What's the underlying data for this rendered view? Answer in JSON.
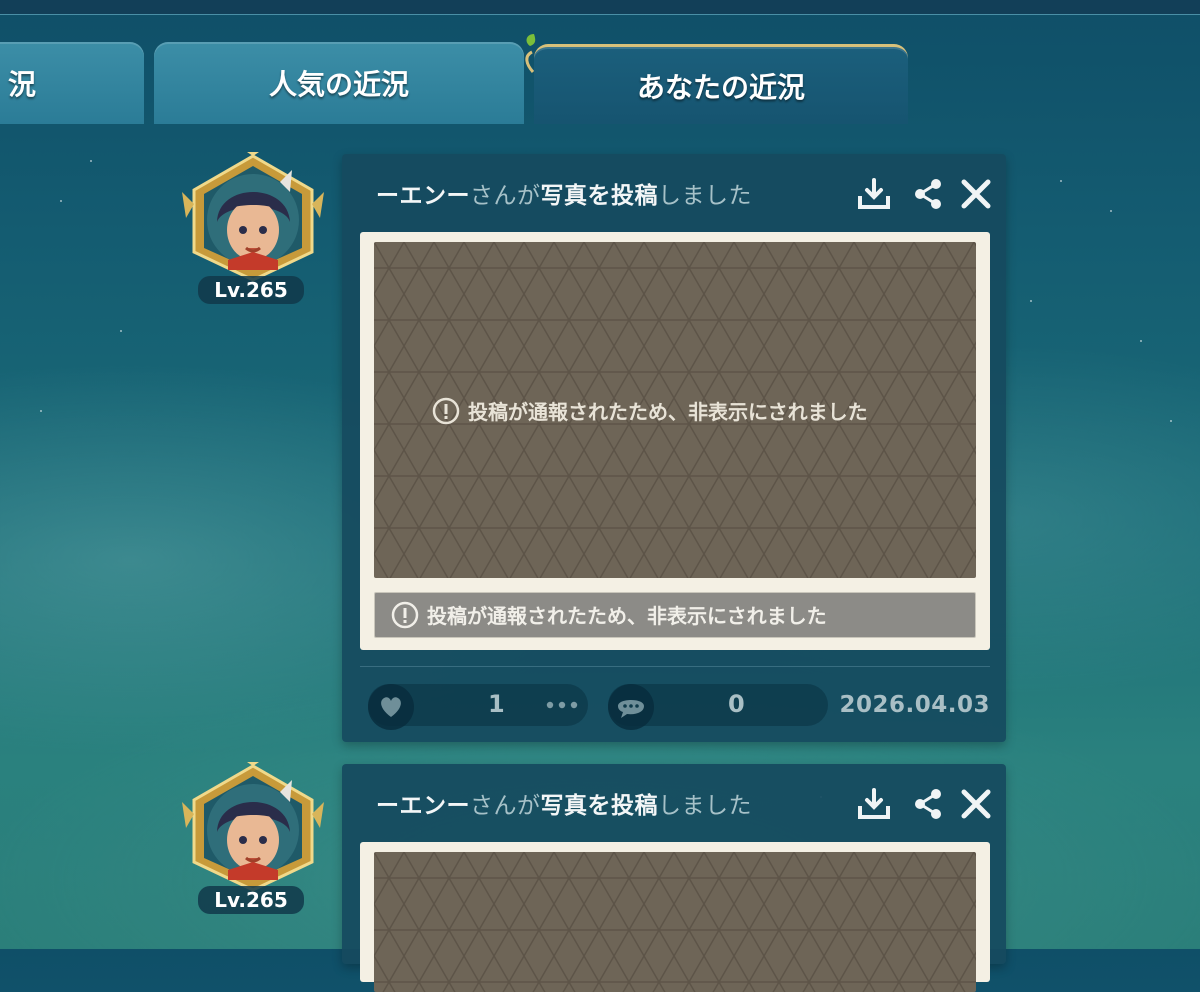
{
  "tabs": [
    {
      "label": "況",
      "active": false
    },
    {
      "label": "人気の近況",
      "active": false
    },
    {
      "label": "あなたの近況",
      "active": true
    }
  ],
  "posts": [
    {
      "user": {
        "name": "ーエンー",
        "level": "Lv.265"
      },
      "action": {
        "san_ga": "さんが",
        "verb": "写真を投稿",
        "suffix": "しました"
      },
      "photo_notice": "投稿が通報されたため、非表示にされました",
      "caption_notice": "投稿が通報されたため、非表示にされました",
      "likes": "1",
      "comments": "0",
      "date": "2026.04.03"
    },
    {
      "user": {
        "name": "ーエンー",
        "level": "Lv.265"
      },
      "action": {
        "san_ga": "さんが",
        "verb": "写真を投稿",
        "suffix": "しました"
      }
    }
  ],
  "icons": {
    "download": "download-icon",
    "share": "share-icon",
    "close": "close-icon",
    "like": "heart-icon",
    "more": "more-dots-icon",
    "comment": "comment-bubble-icon",
    "notice": "exclamation-circle-icon"
  },
  "colors": {
    "gold_frame": "#d8b55a",
    "card_bg": "#164a5f",
    "photo_bg": "#6e6557",
    "frame_bg": "#f4f0e4"
  }
}
